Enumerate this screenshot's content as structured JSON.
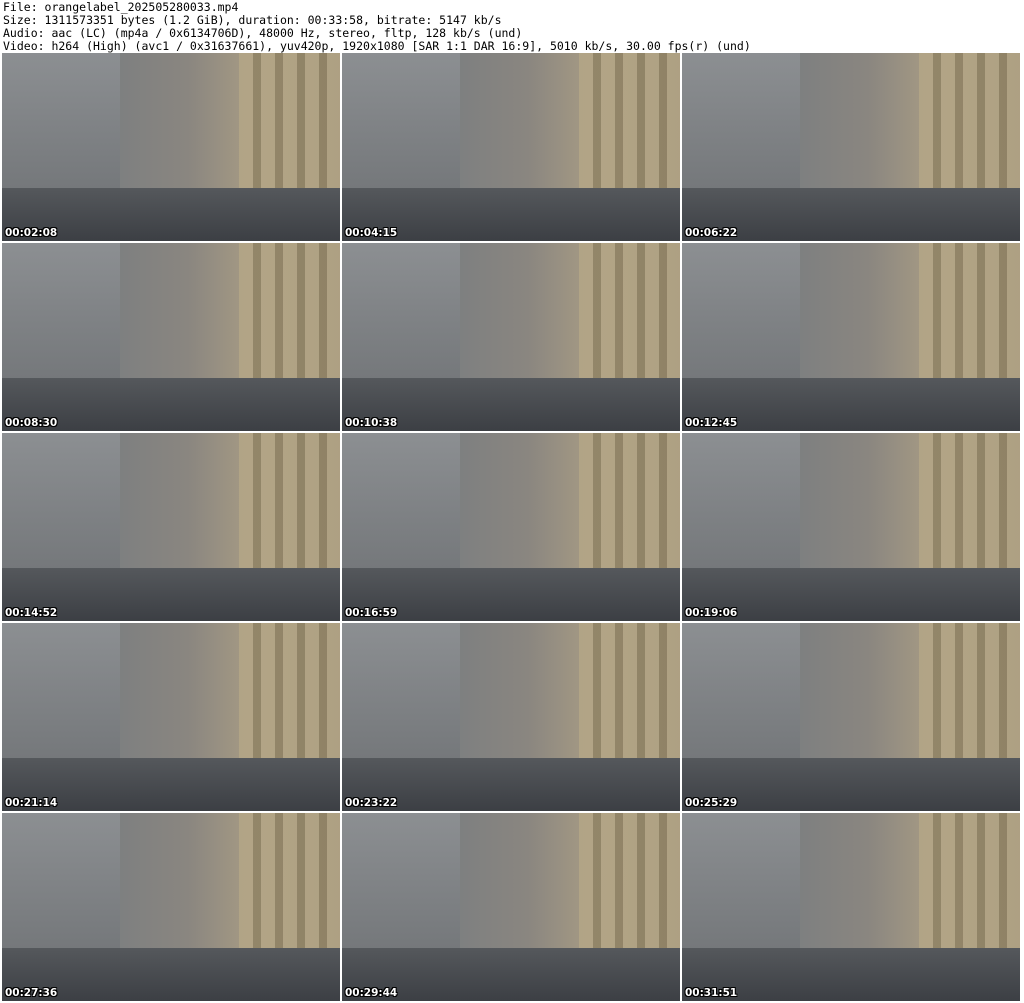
{
  "header": {
    "file": "File: orangelabel_202505280033.mp4",
    "size": "Size: 1311573351 bytes (1.2 GiB), duration: 00:33:58, bitrate: 5147 kb/s",
    "audio": "Audio: aac (LC) (mp4a / 0x6134706D), 48000 Hz, stereo, fltp, 128 kb/s (und)",
    "video": "Video: h264 (High) (avc1 / 0x31637661), yuv420p, 1920x1080 [SAR 1:1 DAR 16:9], 5010 kb/s, 30.00 fps(r) (und)"
  },
  "thumbnails": [
    {
      "time": "00:02:08"
    },
    {
      "time": "00:04:15"
    },
    {
      "time": "00:06:22"
    },
    {
      "time": "00:08:30"
    },
    {
      "time": "00:10:38"
    },
    {
      "time": "00:12:45"
    },
    {
      "time": "00:14:52"
    },
    {
      "time": "00:16:59"
    },
    {
      "time": "00:19:06"
    },
    {
      "time": "00:21:14"
    },
    {
      "time": "00:23:22"
    },
    {
      "time": "00:25:29"
    },
    {
      "time": "00:27:36"
    },
    {
      "time": "00:29:44"
    },
    {
      "time": "00:31:51"
    }
  ]
}
